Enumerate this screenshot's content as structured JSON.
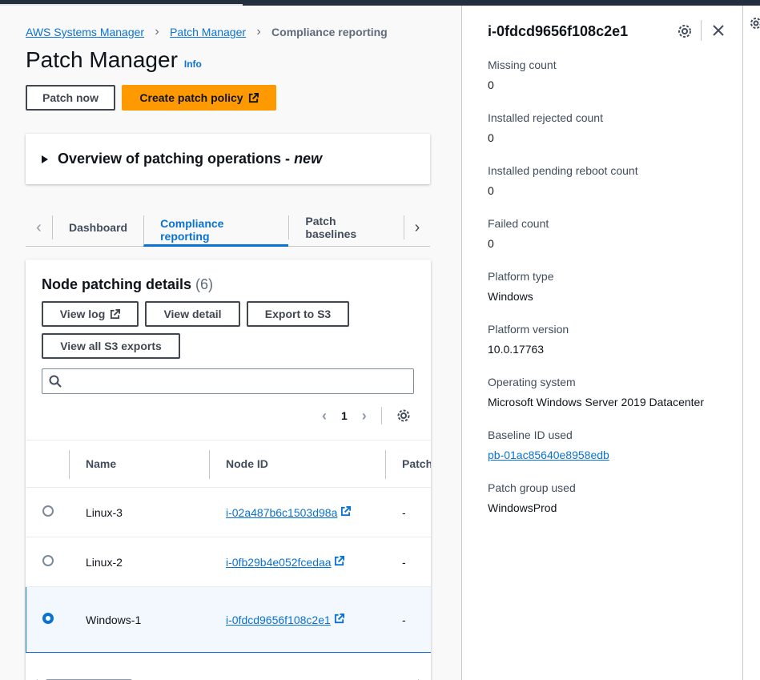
{
  "breadcrumb": {
    "items": [
      "AWS Systems Manager",
      "Patch Manager"
    ],
    "current": "Compliance reporting"
  },
  "header": {
    "title": "Patch Manager",
    "info": "Info"
  },
  "actions": {
    "patch_now": "Patch now",
    "create_policy": "Create patch policy"
  },
  "overview": {
    "title": "Overview of patching operations - ",
    "badge": "new"
  },
  "tabs": [
    {
      "label": "Dashboard"
    },
    {
      "label": "Compliance reporting"
    },
    {
      "label": "Patch baselines"
    }
  ],
  "node_details": {
    "title": "Node patching details",
    "count": "(6)",
    "buttons": {
      "view_log": "View log",
      "view_detail": "View detail",
      "export_s3": "Export to S3",
      "view_all_s3": "View all S3 exports"
    },
    "search": {
      "placeholder": ""
    },
    "page": "1",
    "columns": [
      "Name",
      "Node ID",
      "Patch"
    ],
    "rows": [
      {
        "name": "Linux-3",
        "node_id": "i-02a487b6c1503d98a",
        "patch": "-"
      },
      {
        "name": "Linux-2",
        "node_id": "i-0fb29b4e052fcedaa",
        "patch": "-"
      },
      {
        "name": "Windows-1",
        "node_id": "i-0fdcd9656f108c2e1",
        "patch": "-"
      }
    ]
  },
  "details_panel": {
    "title": "i-0fdcd9656f108c2e1",
    "fields": [
      {
        "label": "Missing count",
        "value": "0"
      },
      {
        "label": "Installed rejected count",
        "value": "0"
      },
      {
        "label": "Installed pending reboot count",
        "value": "0"
      },
      {
        "label": "Failed count",
        "value": "0"
      },
      {
        "label": "Platform type",
        "value": "Windows"
      },
      {
        "label": "Platform version",
        "value": "10.0.17763"
      },
      {
        "label": "Operating system",
        "value": "Microsoft Windows Server 2019 Datacenter"
      },
      {
        "label": "Baseline ID used",
        "value": "pb-01ac85640e8958edb"
      },
      {
        "label": "Patch group used",
        "value": "WindowsProd"
      }
    ]
  },
  "icons": {
    "external": "external-link-icon",
    "settings": "gear-icon",
    "close": "close-icon",
    "search": "search-icon"
  },
  "colors": {
    "accent": "#0972d3",
    "primary_button": "#ff9900",
    "topbar": "#232f3e"
  }
}
